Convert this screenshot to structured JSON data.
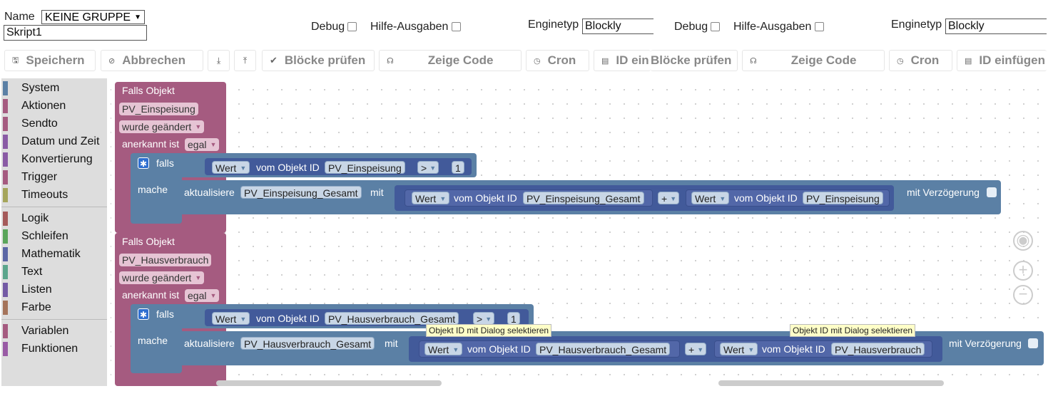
{
  "header": {
    "name_label": "Name",
    "group_select": "KEINE GRUPPE",
    "script_name": "Skript1",
    "debug_label": "Debug",
    "hilfe_label": "Hilfe-Ausgaben",
    "enginetyp_label": "Enginetyp",
    "enginetyp_value": "Blockly"
  },
  "toolbar": {
    "save": "Speichern",
    "cancel": "Abbrechen",
    "check_blocks": "Blöcke prüfen",
    "show_code": "Zeige Code",
    "cron": "Cron",
    "insert_id": "ID einfügen",
    "insert_id_cut": "ID ein"
  },
  "toolbox": {
    "group1": [
      "System",
      "Aktionen",
      "Sendto",
      "Datum und Zeit",
      "Konvertierung",
      "Trigger",
      "Timeouts"
    ],
    "group2": [
      "Logik",
      "Schleifen",
      "Mathematik",
      "Text",
      "Listen",
      "Farbe"
    ],
    "group3": [
      "Variablen",
      "Funktionen"
    ],
    "colors": {
      "group1": [
        "#5b80a5",
        "#a55b80",
        "#a55b80",
        "#8a5ba5",
        "#8a5ba5",
        "#a55b80",
        "#a5a55b"
      ],
      "group2": [
        "#a55b5b",
        "#5ba55b",
        "#5b67a5",
        "#5ba58c",
        "#745ba5",
        "#a5745b"
      ],
      "group3": [
        "#a55b80",
        "#995ba5"
      ]
    }
  },
  "blocks": {
    "b1": {
      "falls_objekt": "Falls Objekt",
      "object": "PV_Einspeisung",
      "changed": "wurde geändert",
      "ack_label": "anerkannt ist",
      "ack_value": "egal",
      "if_label": "falls",
      "wert": "Wert",
      "vom_objekt_id": "vom Objekt ID",
      "cond_obj": "PV_Einspeisung",
      "op": ">",
      "num": "1",
      "mache": "mache",
      "update": "aktualisiere",
      "target": "PV_Einspeisung_Gesamt",
      "mit": "mit",
      "sum_a": "PV_Einspeisung_Gesamt",
      "plus": "+",
      "sum_b": "PV_Einspeisung",
      "delay": "mit Verzögerung"
    },
    "b2": {
      "falls_objekt": "Falls Objekt",
      "object": "PV_Hausverbrauch",
      "changed": "wurde geändert",
      "ack_label": "anerkannt ist",
      "ack_value": "egal",
      "if_label": "falls",
      "wert": "Wert",
      "vom_objekt_id": "vom Objekt ID",
      "cond_obj": "PV_Hausverbrauch_Gesamt",
      "op": ">",
      "num": "1",
      "mache": "mache",
      "update": "aktualisiere",
      "target": "PV_Hausverbrauch_Gesamt",
      "mit": "mit",
      "sum_a": "PV_Hausverbrauch_Gesamt",
      "plus": "+",
      "sum_b": "PV_Hausverbrauch",
      "delay": "mit Verzögerung"
    },
    "tooltip": "Objekt ID mit Dialog selektieren"
  }
}
